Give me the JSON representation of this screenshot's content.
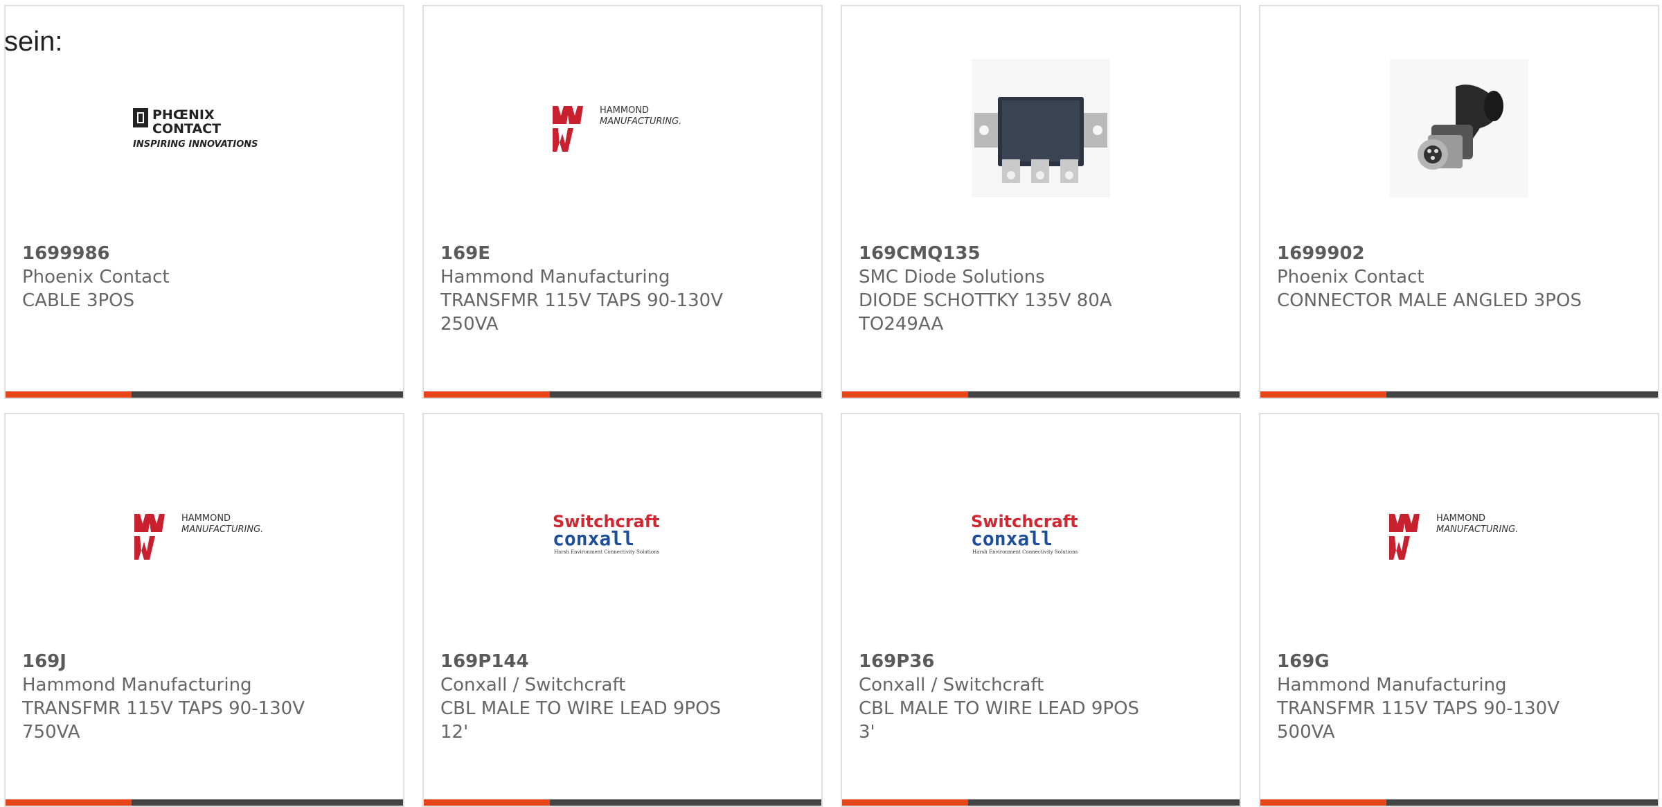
{
  "intro_text": "sein:",
  "colors": {
    "accent": "#e8451a",
    "bar": "#444444",
    "border": "#dedede",
    "hammond_red": "#c8202e",
    "switchcraft_red": "#d22630",
    "conxall_blue": "#1d4e9a"
  },
  "products": [
    {
      "part_number": "1699986",
      "manufacturer": "Phoenix Contact",
      "description": "CABLE 3POS",
      "image": "phoenix-contact-logo",
      "logo_line1": "PHŒNIX",
      "logo_line2": "CONTACT",
      "logo_tagline": "INSPIRING INNOVATIONS"
    },
    {
      "part_number": "169E",
      "manufacturer": "Hammond Manufacturing",
      "description": "TRANSFMR 115V TAPS 90-130V 250VA",
      "image": "hammond-logo",
      "logo_line1": "HAMMOND",
      "logo_line2": "MANUFACTURING."
    },
    {
      "part_number": "169CMQ135",
      "manufacturer": "SMC Diode Solutions",
      "description": "DIODE SCHOTTKY 135V 80A TO249AA",
      "image": "diode-module-photo"
    },
    {
      "part_number": "1699902",
      "manufacturer": "Phoenix Contact",
      "description": "CONNECTOR MALE ANGLED 3POS",
      "image": "angled-connector-photo"
    },
    {
      "part_number": "169J",
      "manufacturer": "Hammond Manufacturing",
      "description": "TRANSFMR 115V TAPS 90-130V 750VA",
      "image": "hammond-logo",
      "logo_line1": "HAMMOND",
      "logo_line2": "MANUFACTURING."
    },
    {
      "part_number": "169P144",
      "manufacturer": "Conxall / Switchcraft",
      "description": "CBL MALE TO WIRE LEAD 9POS 12'",
      "image": "switchcraft-conxall-logo",
      "logo_line1": "Switchcraft",
      "logo_line2": "conxall",
      "logo_tagline": "Harsh Environment Connectivity Solutions"
    },
    {
      "part_number": "169P36",
      "manufacturer": "Conxall / Switchcraft",
      "description": "CBL MALE TO WIRE LEAD 9POS 3'",
      "image": "switchcraft-conxall-logo",
      "logo_line1": "Switchcraft",
      "logo_line2": "conxall",
      "logo_tagline": "Harsh Environment Connectivity Solutions"
    },
    {
      "part_number": "169G",
      "manufacturer": "Hammond Manufacturing",
      "description": "TRANSFMR 115V TAPS 90-130V 500VA",
      "image": "hammond-logo",
      "logo_line1": "HAMMOND",
      "logo_line2": "MANUFACTURING."
    }
  ]
}
